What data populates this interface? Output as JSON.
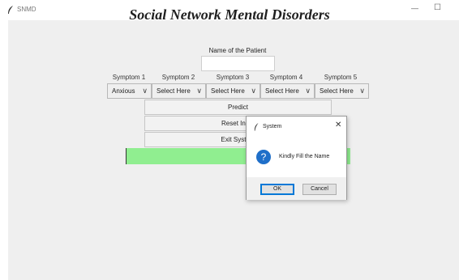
{
  "window": {
    "title": "SNMD",
    "minimize_glyph": "—",
    "maximize_glyph": "☐",
    "close_glyph": ""
  },
  "app": {
    "heading": "Social Network Mental Disorders",
    "name_label": "Name of the Patient",
    "name_value": "",
    "symptoms": [
      {
        "label": "Symptom 1",
        "value": "Anxious"
      },
      {
        "label": "Symptom 2",
        "value": "Select Here"
      },
      {
        "label": "Symptom 3",
        "value": "Select Here"
      },
      {
        "label": "Symptom 4",
        "value": "Select Here"
      },
      {
        "label": "Symptom 5",
        "value": "Select Here"
      }
    ],
    "chevron": "∨",
    "buttons": {
      "predict": "Predict",
      "reset": "Reset Input",
      "exit": "Exit System"
    },
    "result_color": "#90ee90"
  },
  "dialog": {
    "title": "System",
    "close_glyph": "✕",
    "icon": "question-icon",
    "icon_glyph": "?",
    "message": "Kindly Fill the Name",
    "ok": "OK",
    "cancel": "Cancel"
  },
  "colors": {
    "accent": "#1f6fc9",
    "focus": "#0078d7",
    "background": "#efefef"
  }
}
